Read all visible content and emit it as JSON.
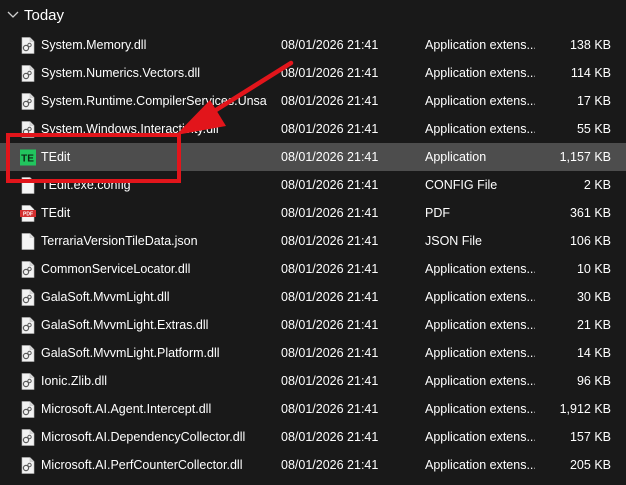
{
  "group": {
    "title": "Today"
  },
  "files": [
    {
      "name": "System.Memory.dll",
      "date": "08/01/2026 21:41",
      "type": "Application extens...",
      "size": "138 KB",
      "icon": "dll-file-icon"
    },
    {
      "name": "System.Numerics.Vectors.dll",
      "date": "08/01/2026 21:41",
      "type": "Application extens...",
      "size": "114 KB",
      "icon": "dll-file-icon"
    },
    {
      "name": "System.Runtime.CompilerServices.Unsaf...",
      "date": "08/01/2026 21:41",
      "type": "Application extens...",
      "size": "17 KB",
      "icon": "dll-file-icon"
    },
    {
      "name": "System.Windows.Interactivity.dll",
      "date": "08/01/2026 21:41",
      "type": "Application extens...",
      "size": "55 KB",
      "icon": "dll-file-icon"
    },
    {
      "name": "TEdit",
      "date": "08/01/2026 21:41",
      "type": "Application",
      "size": "1,157 KB",
      "icon": "tedit-app-icon",
      "selected": true
    },
    {
      "name": "TEdit.exe.config",
      "date": "08/01/2026 21:41",
      "type": "CONFIG File",
      "size": "2 KB",
      "icon": "blank-file-icon"
    },
    {
      "name": "TEdit",
      "date": "08/01/2026 21:41",
      "type": "PDF",
      "size": "361 KB",
      "icon": "pdf-file-icon"
    },
    {
      "name": "TerrariaVersionTileData.json",
      "date": "08/01/2026 21:41",
      "type": "JSON File",
      "size": "106 KB",
      "icon": "blank-file-icon"
    },
    {
      "name": "CommonServiceLocator.dll",
      "date": "08/01/2026 21:41",
      "type": "Application extens...",
      "size": "10 KB",
      "icon": "dll-file-icon"
    },
    {
      "name": "GalaSoft.MvvmLight.dll",
      "date": "08/01/2026 21:41",
      "type": "Application extens...",
      "size": "30 KB",
      "icon": "dll-file-icon"
    },
    {
      "name": "GalaSoft.MvvmLight.Extras.dll",
      "date": "08/01/2026 21:41",
      "type": "Application extens...",
      "size": "21 KB",
      "icon": "dll-file-icon"
    },
    {
      "name": "GalaSoft.MvvmLight.Platform.dll",
      "date": "08/01/2026 21:41",
      "type": "Application extens...",
      "size": "14 KB",
      "icon": "dll-file-icon"
    },
    {
      "name": "Ionic.Zlib.dll",
      "date": "08/01/2026 21:41",
      "type": "Application extens...",
      "size": "96 KB",
      "icon": "dll-file-icon"
    },
    {
      "name": "Microsoft.AI.Agent.Intercept.dll",
      "date": "08/01/2026 21:41",
      "type": "Application extens...",
      "size": "1,912 KB",
      "icon": "dll-file-icon"
    },
    {
      "name": "Microsoft.AI.DependencyCollector.dll",
      "date": "08/01/2026 21:41",
      "type": "Application extens...",
      "size": "157 KB",
      "icon": "dll-file-icon"
    },
    {
      "name": "Microsoft.AI.PerfCounterCollector.dll",
      "date": "08/01/2026 21:41",
      "type": "Application extens...",
      "size": "205 KB",
      "icon": "dll-file-icon"
    }
  ],
  "annotation": {
    "highlight_color": "#e2151b",
    "arrow_color": "#e2151b"
  },
  "colors": {
    "background": "#191919",
    "selected_row": "#4d4d4d",
    "tedit_icon_green": "#22c55e",
    "pdf_red": "#d32f2f"
  }
}
